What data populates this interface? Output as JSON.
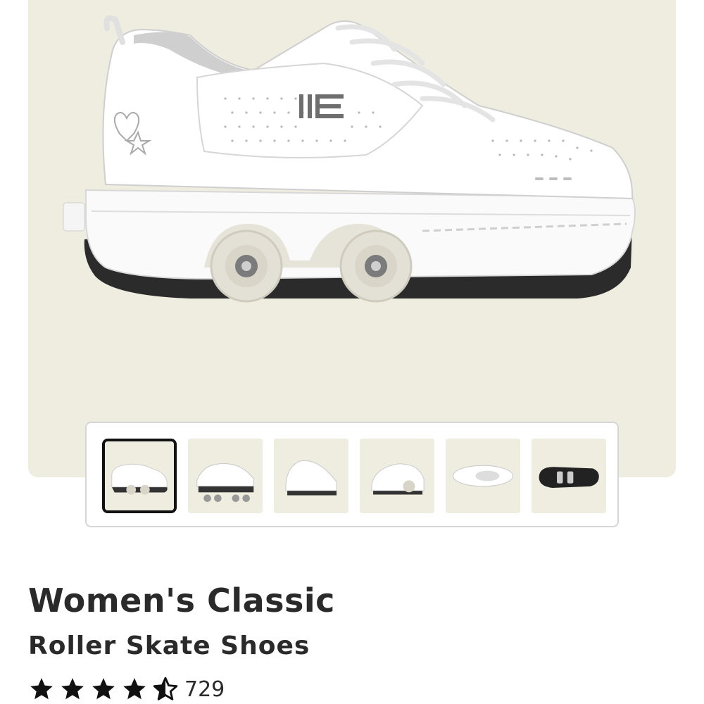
{
  "product": {
    "title": "Women's Classic",
    "subtitle": "Roller Skate Shoes",
    "rating_value": 4.5,
    "rating_count": "729"
  },
  "gallery": {
    "main_image_icon": "roller-skate-shoe",
    "thumbnails": [
      {
        "view": "side",
        "selected": true
      },
      {
        "view": "angled-front",
        "selected": false
      },
      {
        "view": "front-angle",
        "selected": false
      },
      {
        "view": "back-angle",
        "selected": false
      },
      {
        "view": "top",
        "selected": false
      },
      {
        "view": "bottom",
        "selected": false
      }
    ]
  },
  "colors": {
    "hero_background": "#efece0",
    "text": "#2a2a2a",
    "thumb_border_active": "#111111"
  }
}
